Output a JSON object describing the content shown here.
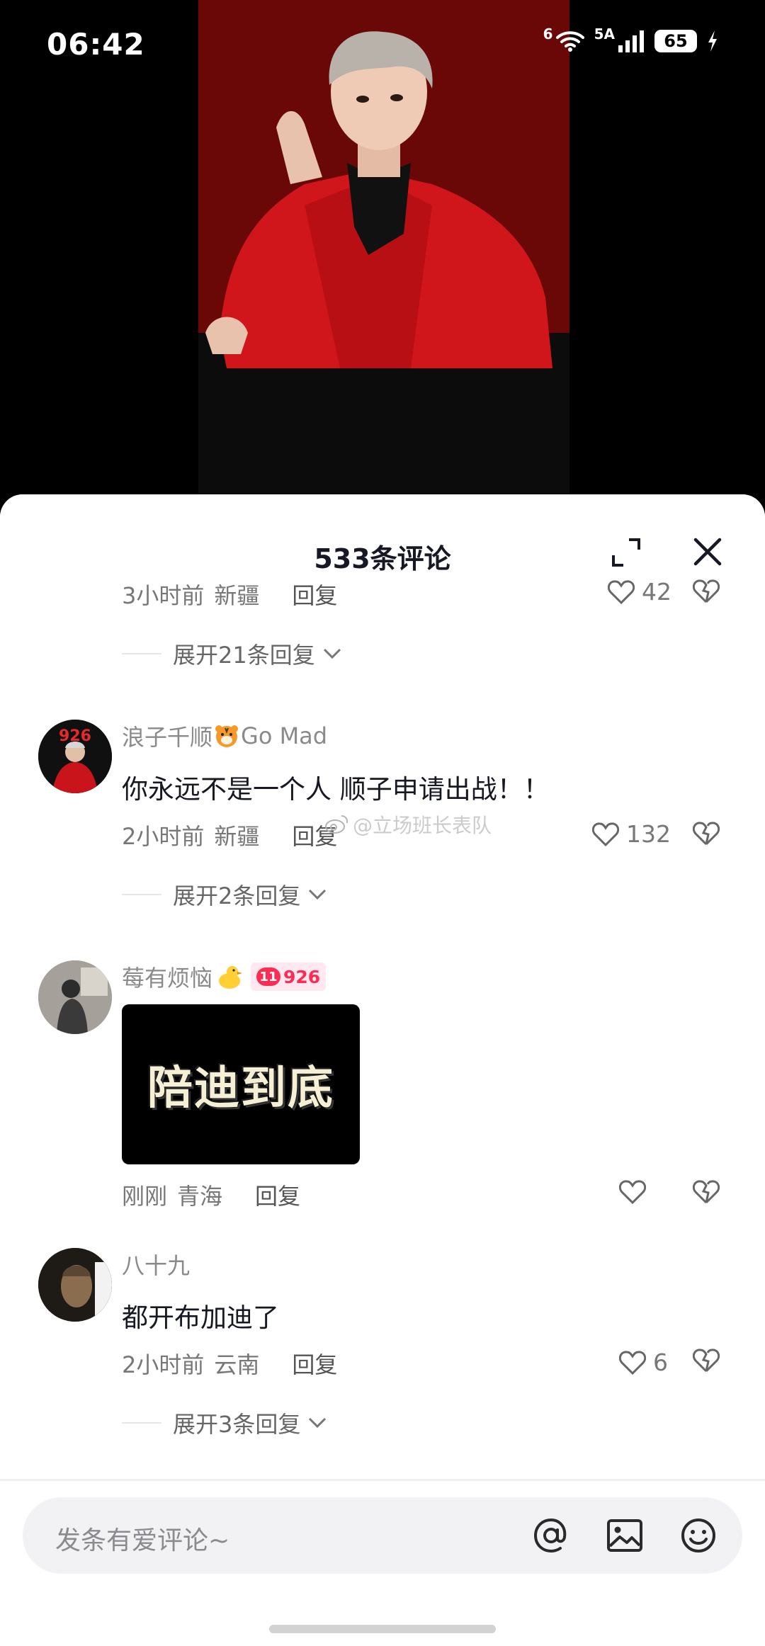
{
  "status_bar": {
    "time": "06:42",
    "wifi_tag": "6",
    "network_tag": "5A",
    "battery": "65"
  },
  "sheet": {
    "title": "533条评论"
  },
  "partial_row": {
    "time": "3小时前",
    "region": "新疆",
    "reply": "回复",
    "likes": "42"
  },
  "expand_rows": [
    "展开21条回复",
    "展开2条回复",
    "展开3条回复"
  ],
  "comments": [
    {
      "username": "浪子千顺",
      "username_suffix": "Go Mad",
      "avatar_text": "926",
      "text": "你永远不是一个人  顺子申请出战！！",
      "time": "2小时前",
      "region": "新疆",
      "reply": "回复",
      "likes": "132"
    },
    {
      "username": "莓有烦恼",
      "badge_level": "11",
      "badge_text": "926",
      "image_text": "陪迪到底",
      "time": "刚刚",
      "region": "青海",
      "reply": "回复",
      "likes": ""
    },
    {
      "username": "八十九",
      "text": "都开布加迪了",
      "time": "2小时前",
      "region": "云南",
      "reply": "回复",
      "likes": "6"
    }
  ],
  "watermark": "@立场班长表队",
  "input": {
    "placeholder": "发条有爱评论~"
  },
  "colors": {
    "accent": "#fe2c55",
    "text_primary": "#161823",
    "text_secondary": "#8a8a8a"
  },
  "icons": [
    "wifi-icon",
    "signal-icon",
    "charging-icon",
    "expand-icon",
    "close-icon",
    "chevron-down-icon",
    "heart-icon",
    "dislike-heart-icon",
    "at-icon",
    "image-icon",
    "emoji-icon"
  ]
}
